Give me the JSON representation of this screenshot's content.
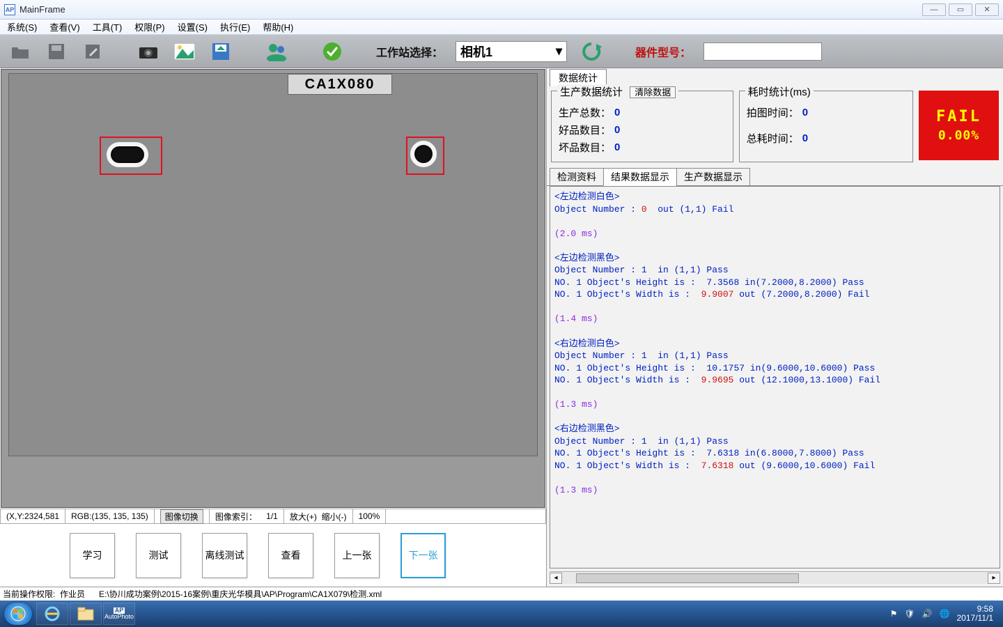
{
  "window": {
    "title": "MainFrame",
    "app_icon": "AP"
  },
  "menu": [
    "系统(S)",
    "查看(V)",
    "工具(T)",
    "权限(P)",
    "设置(S)",
    "执行(E)",
    "帮助(H)"
  ],
  "toolbar": {
    "station_label": "工作站选择：",
    "station_value": "相机1",
    "model_label": "器件型号："
  },
  "image_view": {
    "part_label": "CA1X080",
    "coord": "(X,Y:2324,581",
    "rgb": "RGB:(135, 135, 135)",
    "switch_btn": "图像切换",
    "index_label": "图像索引：",
    "index_value": "1/1",
    "zoom_in": "放大(+)",
    "zoom_out": "缩小(-)",
    "zoom_pct": "100%"
  },
  "buttons": {
    "study": "学习",
    "test": "测试",
    "offline": "离线测试",
    "view": "查看",
    "prev": "上一张",
    "next": "下一张"
  },
  "stats_tab": "数据统计",
  "prod_stats": {
    "title": "生产数据统计",
    "clear_btn": "清除数据",
    "total_label": "生产总数：",
    "total_val": "0",
    "good_label": "好品数目：",
    "good_val": "0",
    "bad_label": "坏品数目：",
    "bad_val": "0"
  },
  "time_stats": {
    "title": "耗时统计(ms)",
    "capture_label": "拍图时间：",
    "capture_val": "0",
    "total_label": "总耗时间：",
    "total_val": "0"
  },
  "fail_box": {
    "status": "FAIL",
    "pct": "0.00%"
  },
  "result_tabs": [
    "检测资料",
    "结果数据显示",
    "生产数据显示"
  ],
  "results": {
    "s1_title": "<左边检测白色>",
    "s1_l1a": "Object Number : ",
    "s1_l1b": "0",
    "s1_l1c": "  out (1,1) Fail",
    "s1_t": "(2.0 ms)",
    "s2_title": "<左边检测黑色>",
    "s2_l1": "Object Number : 1  in (1,1) Pass",
    "s2_l2": "NO. 1 Object's Height is :  7.3568 in(7.2000,8.2000) Pass",
    "s2_l3a": "NO. 1 Object's Width is :  ",
    "s2_l3b": "9.9007",
    "s2_l3c": " out (7.2000,8.2000) Fail",
    "s2_t": "(1.4 ms)",
    "s3_title": "<右边检测白色>",
    "s3_l1": "Object Number : 1  in (1,1) Pass",
    "s3_l2": "NO. 1 Object's Height is :  10.1757 in(9.6000,10.6000) Pass",
    "s3_l3a": "NO. 1 Object's Width is :  ",
    "s3_l3b": "9.9695",
    "s3_l3c": " out (12.1000,13.1000) Fail",
    "s3_t": "(1.3 ms)",
    "s4_title": "<右边检测黑色>",
    "s4_l1": "Object Number : 1  in (1,1) Pass",
    "s4_l2": "NO. 1 Object's Height is :  7.6318 in(6.8000,7.8000) Pass",
    "s4_l3a": "NO. 1 Object's Width is :  ",
    "s4_l3b": "7.6318",
    "s4_l3c": " out (9.6000,10.6000) Fail",
    "s4_t": "(1.3 ms)"
  },
  "footer": {
    "perm_label": "当前操作权限:",
    "perm_value": "作业员",
    "path": "E:\\协川成功案例\\2015-16案例\\重庆光华模具\\AP\\Program\\CA1X079\\检测.xml"
  },
  "taskbar": {
    "autophoto": "AutoPhoto",
    "ap": "AP",
    "time": "9:58",
    "date": "2017/11/1"
  }
}
